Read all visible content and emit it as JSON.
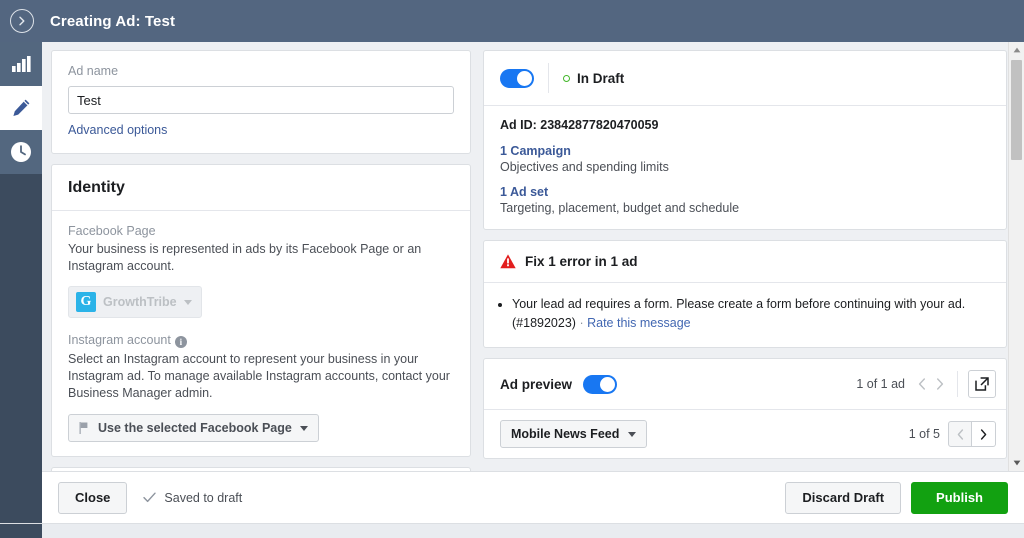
{
  "header": {
    "title": "Creating Ad: Test",
    "back_icon": "chevron-right-circle-icon"
  },
  "sidebar": {
    "items": [
      {
        "icon": "bar-chart-icon",
        "name": "analytics",
        "active": false
      },
      {
        "icon": "pencil-icon",
        "name": "edit",
        "active": true
      },
      {
        "icon": "clock-icon",
        "name": "history",
        "active": false
      }
    ]
  },
  "ad_name_card": {
    "label": "Ad name",
    "value": "Test",
    "placeholder": "Ad name",
    "advanced_options": "Advanced options"
  },
  "identity_card": {
    "title": "Identity",
    "facebook_page": {
      "label": "Facebook Page",
      "description": "Your business is represented in ads by its Facebook Page or an Instagram account.",
      "selected": "GrowthTribe",
      "logo_letter": "G",
      "logo_color": "#2bb3e8",
      "disabled": true
    },
    "instagram_account": {
      "label": "Instagram account",
      "info_icon": "info-icon",
      "description": "Select an Instagram account to represent your business in your Instagram ad. To manage available Instagram accounts, contact your Business Manager admin.",
      "selected": "Use the selected Facebook Page"
    }
  },
  "status_card": {
    "toggle_on": true,
    "status_label": "In Draft",
    "status_color": "#42b72a",
    "ad_id": "Ad ID: 23842877820470059",
    "links": [
      {
        "title": "1 Campaign",
        "description": "Objectives and spending limits"
      },
      {
        "title": "1 Ad set",
        "description": "Targeting, placement, budget and schedule"
      }
    ]
  },
  "error_card": {
    "icon": "warning-triangle-icon",
    "icon_color": "#e21e1e",
    "title": "Fix 1 error in 1 ad",
    "messages": [
      {
        "text": "Your lead ad requires a form. Please create a form before continuing with your ad. (#1892023)",
        "separator": "·",
        "rate_link": "Rate this message"
      }
    ]
  },
  "preview_card": {
    "title": "Ad preview",
    "toggle_on": true,
    "ad_count": "1 of 1 ad",
    "prev_icon": "chevron-left-icon",
    "next_icon": "chevron-right-icon",
    "open_icon": "external-link-icon",
    "format_selected": "Mobile News Feed",
    "page_count": "1 of 5"
  },
  "footer": {
    "close_label": "Close",
    "saved_icon": "check-icon",
    "saved_label": "Saved to draft",
    "discard_label": "Discard Draft",
    "publish_label": "Publish",
    "publish_color": "#12a111"
  }
}
